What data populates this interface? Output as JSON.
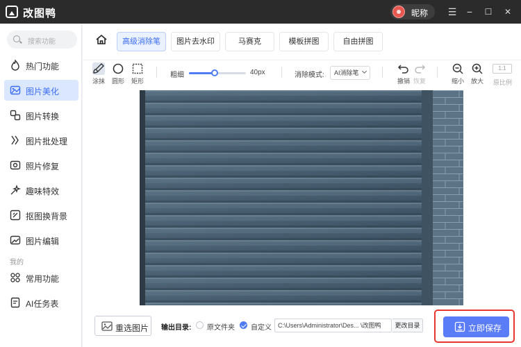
{
  "app": {
    "title": "改图鸭",
    "nickname": "昵称"
  },
  "window_controls": {
    "menu": "☰",
    "minimize": "−",
    "maximize": "☐",
    "close": "✕"
  },
  "sidebar": {
    "search_placeholder": "搜索功能",
    "items": [
      {
        "label": "热门功能",
        "icon": "fire-icon"
      },
      {
        "label": "图片美化",
        "icon": "image-beautify-icon",
        "active": true
      },
      {
        "label": "图片转换",
        "icon": "convert-icon"
      },
      {
        "label": "图片批处理",
        "icon": "batch-icon"
      },
      {
        "label": "照片修复",
        "icon": "repair-icon"
      },
      {
        "label": "趣味特效",
        "icon": "sparkle-icon"
      },
      {
        "label": "抠图换背景",
        "icon": "cutout-icon"
      },
      {
        "label": "图片编辑",
        "icon": "edit-icon"
      }
    ],
    "section_label": "我的",
    "my_items": [
      {
        "label": "常用功能",
        "icon": "grid-icon"
      },
      {
        "label": "AI任务表",
        "icon": "task-list-icon"
      }
    ]
  },
  "tabs": [
    {
      "label": "高级消除笔",
      "active": true
    },
    {
      "label": "图片去水印"
    },
    {
      "label": "马赛克"
    },
    {
      "label": "模板拼图"
    },
    {
      "label": "自由拼图"
    }
  ],
  "toolbar": {
    "tools": [
      {
        "label": "涂抹",
        "icon": "brush-icon",
        "active": true
      },
      {
        "label": "圆形",
        "icon": "circle-icon"
      },
      {
        "label": "矩形",
        "icon": "rectangle-icon"
      }
    ],
    "thickness_label": "粗细",
    "thickness_value": "40px",
    "thickness_fraction": 0.45,
    "mode_label": "消除模式:",
    "mode_value": "AI消除笔",
    "undo_label": "撤销",
    "redo_label": "恢复",
    "zoom_out_label": "缩小",
    "zoom_in_label": "放大",
    "ratio_label": "1:1",
    "original_ratio_label": "原比例"
  },
  "bottom": {
    "reselect_label": "重选图片",
    "output_dir_label": "输出目录:",
    "option_original": "原文件夹",
    "option_custom": "自定义",
    "custom_selected": true,
    "path_value": "C:\\Users\\Administrator\\Des... \\改图鸭",
    "change_dir_label": "更改目录",
    "save_label": "立即保存"
  },
  "colors": {
    "accent": "#4f7cf6",
    "highlight_border": "#e8372f",
    "titlebar": "#2b2b2b"
  }
}
